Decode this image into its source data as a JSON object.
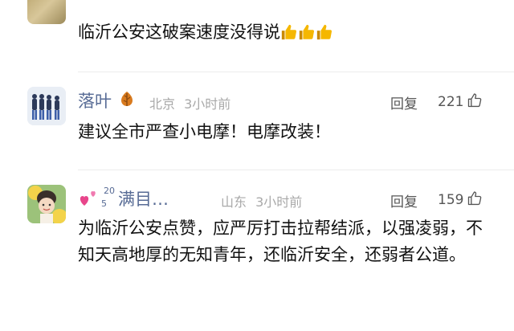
{
  "comment1": {
    "text": "临沂公安这破案速度没得说",
    "emoji": [
      "thumbs-up",
      "thumbs-up",
      "thumbs-up"
    ]
  },
  "comment2": {
    "name": "落叶",
    "name_icon": "fallen-leaf-icon",
    "location": "北京",
    "time": "3小时前",
    "reply": "回复",
    "likes": "221",
    "text": "建议全市严查小电摩！电摩改装！"
  },
  "comment3": {
    "name_prefix_icon": "pink-hearts-icon",
    "name_sup": "20",
    "name_sub": "5",
    "name": "满目…",
    "location": "山东",
    "time": "3小时前",
    "reply": "回复",
    "likes": "159",
    "text": "为临沂公安点赞，应严厉打击拉帮结派，以强凌弱，不知天高地厚的无知青年，还临沂安全，还弱者公道。"
  },
  "colors": {
    "name": "#576b95",
    "meta": "#a9a9a9",
    "text": "#111111",
    "accent_thumb": "#f5b700"
  }
}
